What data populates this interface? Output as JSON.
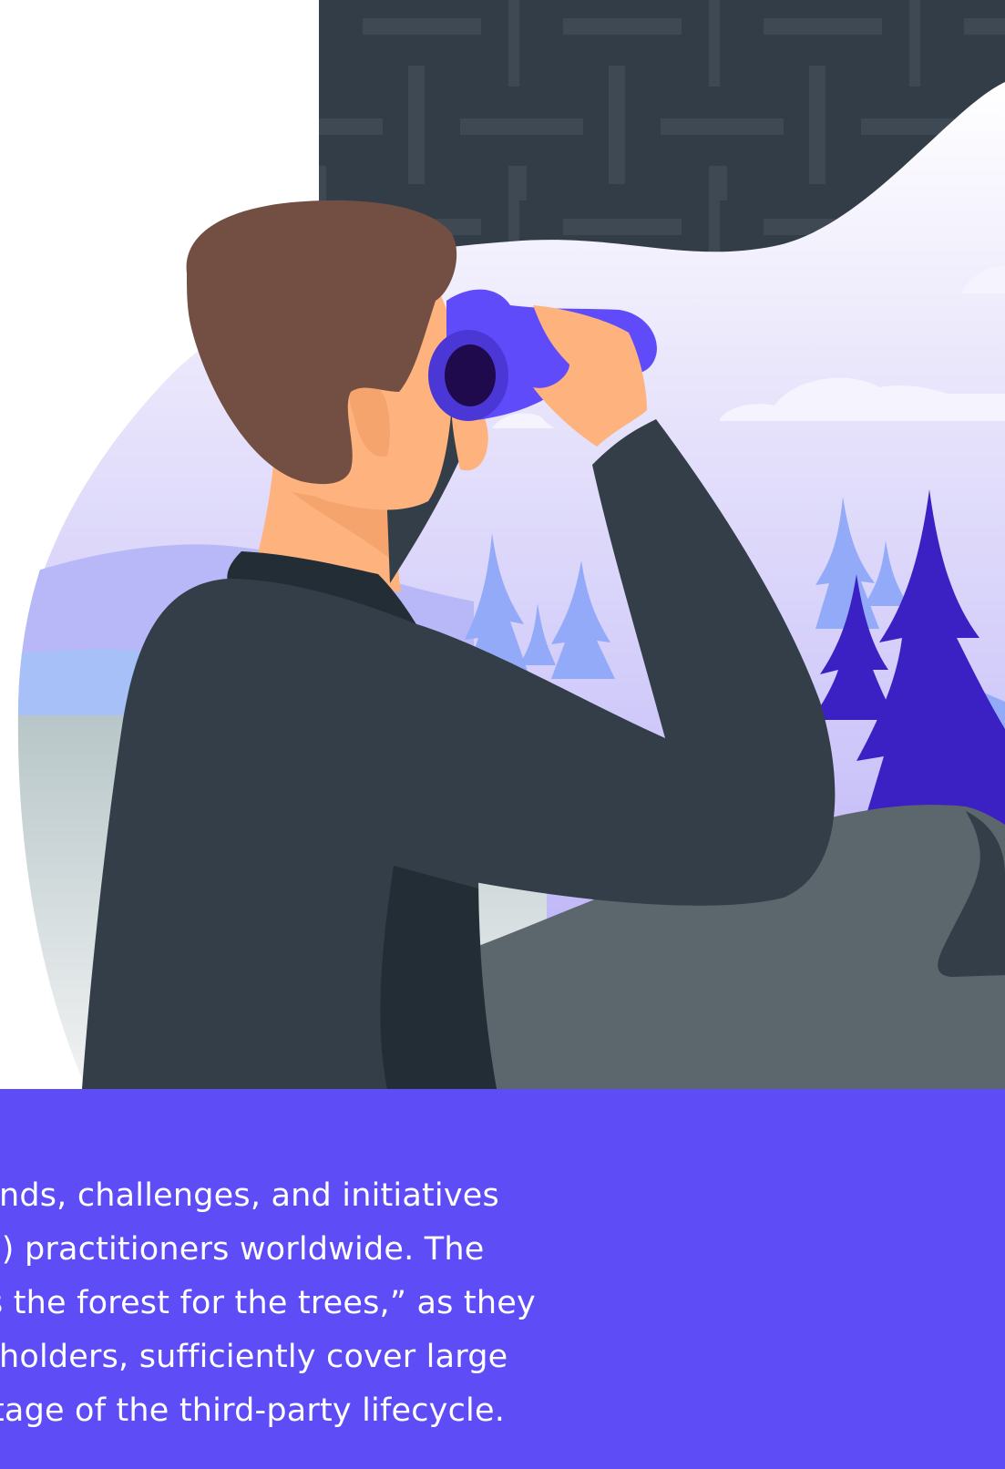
{
  "intro": {
    "lines": [
      "of trends, challenges, and initiatives",
      "TPRM) practitioners worldwide. The",
      "“miss the forest for the trees,” as they",
      "stakeholders, sufficiently cover large",
      "ery stage of the third-party lifecycle."
    ]
  },
  "colors": {
    "panel": "#5e4cf7",
    "jacket": "#333e48",
    "hair": "#734f43",
    "skin": "#feb27d",
    "binoculars": "#5f4bfa",
    "tree_dark": "#3b20c4",
    "tree_light": "#93aaf9",
    "pattern_bg": "#333d48"
  }
}
